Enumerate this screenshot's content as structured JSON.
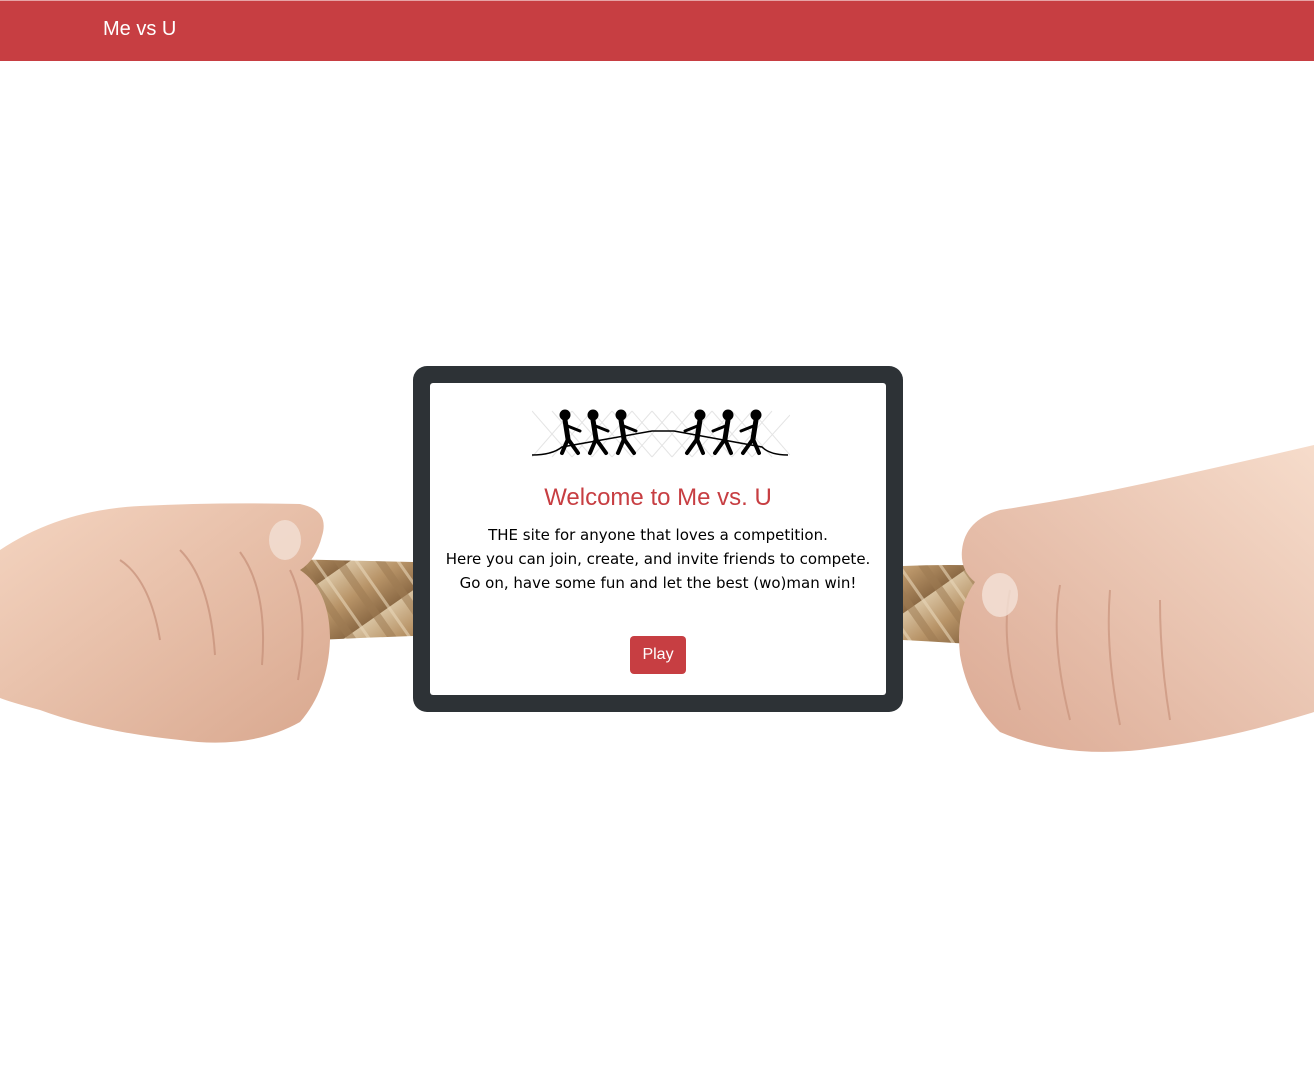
{
  "navbar": {
    "brand": "Me vs U",
    "background_color": "#c73e42"
  },
  "background_image": {
    "icon": "tug-of-war-hands-rope-image"
  },
  "card": {
    "logo_icon": "tug-of-war-team-icon",
    "title": "Welcome to Me vs. U",
    "lines": [
      "THE site for anyone that loves a competition.",
      "Here you can join, create, and invite friends to compete.",
      "Go on, have some fun and let the best (wo)man win!"
    ],
    "play_label": "Play",
    "accent_color": "#c73e42",
    "frame_color": "#2d3236"
  }
}
